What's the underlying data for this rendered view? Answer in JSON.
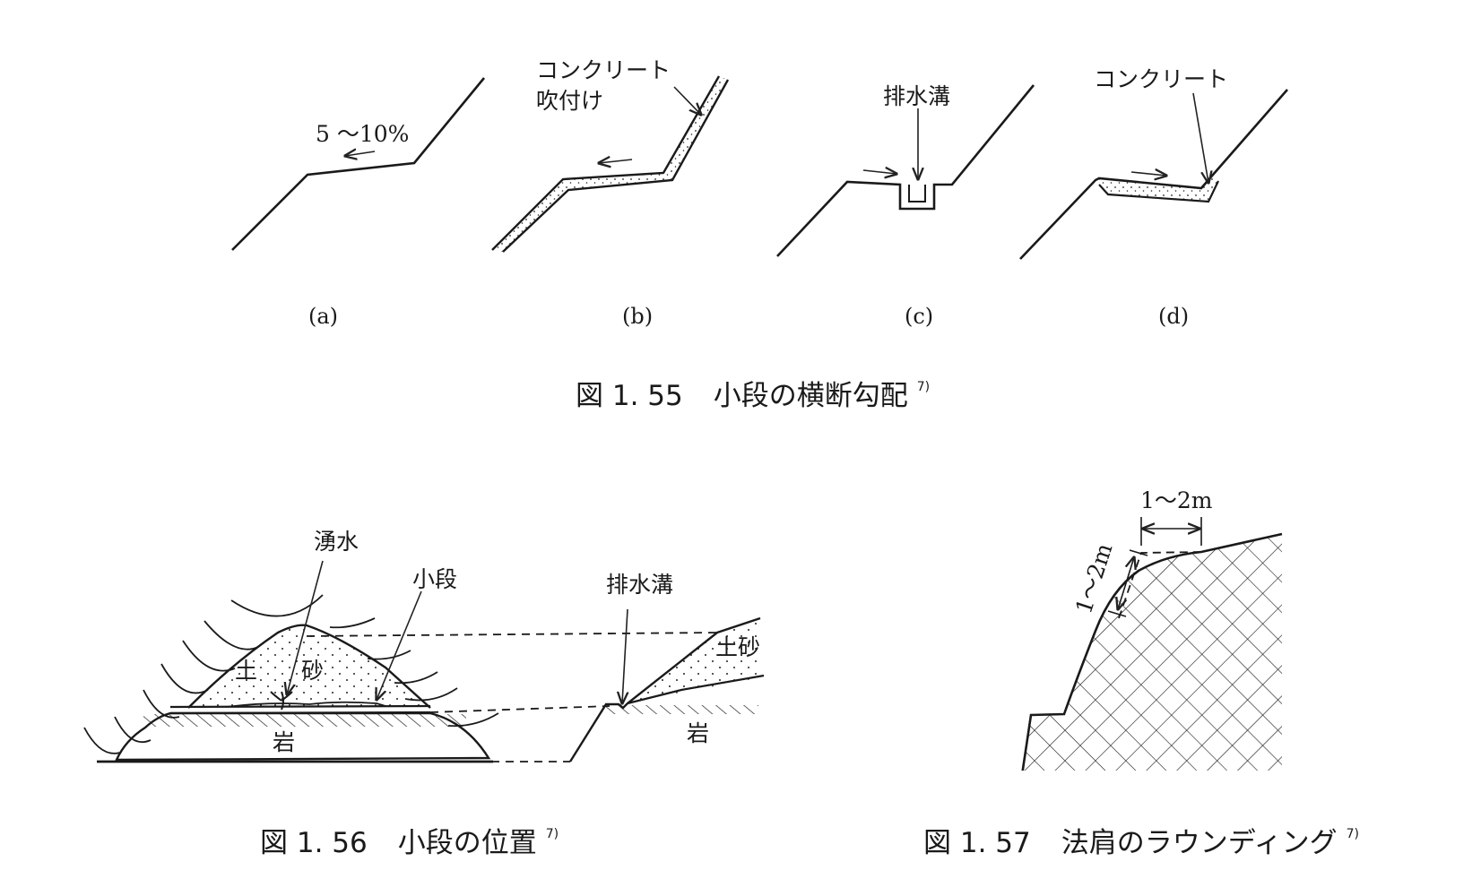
{
  "fig155": {
    "caption_num": "図 1. 55",
    "caption_text": "小段の横断勾配",
    "caption_ref": "7)",
    "a": {
      "label": "(a)",
      "slope": "5 〜10%"
    },
    "b": {
      "label": "(b)",
      "note_line1": "コンクリート",
      "note_line2": "吹付け"
    },
    "c": {
      "label": "(c)",
      "note": "排水溝"
    },
    "d": {
      "label": "(d)",
      "note": "コンクリート"
    }
  },
  "fig156": {
    "caption_num": "図 1. 56",
    "caption_text": "小段の位置",
    "caption_ref": "7)",
    "spring": "湧水",
    "berm": "小段",
    "ditch": "排水溝",
    "soil_char1": "土",
    "soil_char2": "砂",
    "soil_right": "土砂",
    "rock_left": "岩",
    "rock_right": "岩"
  },
  "fig157": {
    "caption_num": "図 1. 57",
    "caption_text": "法肩のラウンディング",
    "caption_ref": "7)",
    "horiz": "1〜2m",
    "slant": "1〜2m"
  }
}
